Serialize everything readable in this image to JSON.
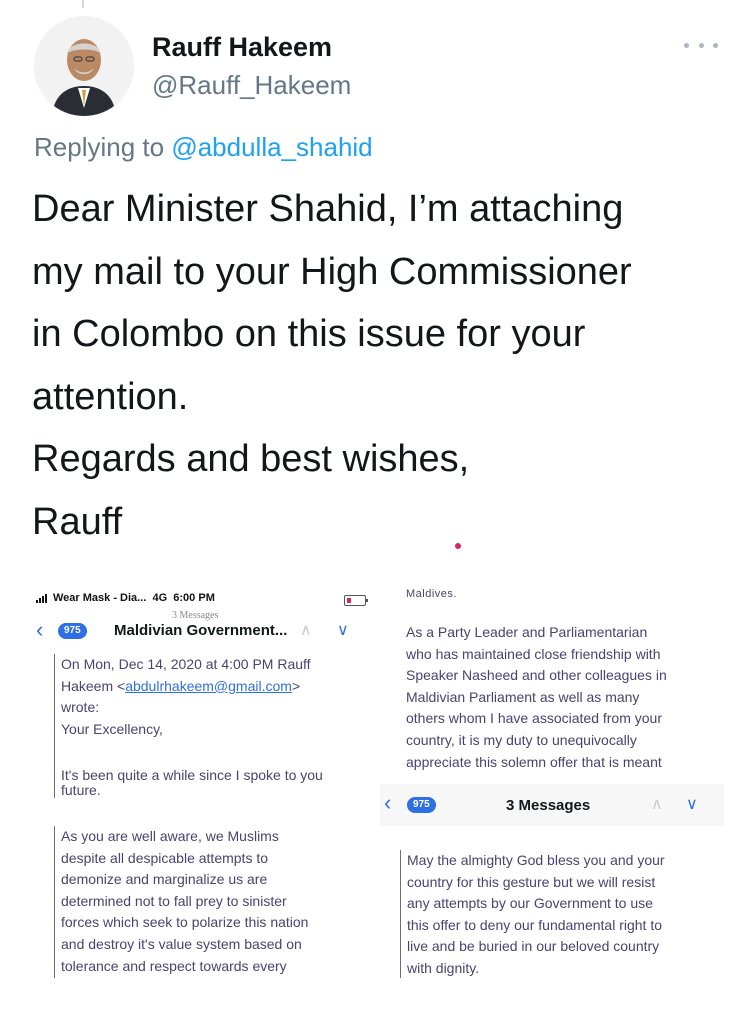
{
  "tweet": {
    "author_name": "Rauff Hakeem",
    "author_handle": "@Rauff_Hakeem",
    "replying_prefix": "Replying to",
    "replying_to": "@abdulla_shahid",
    "lines": [
      "Dear Minister Shahid, I’m attaching",
      "my mail to your High Commissioner",
      "in Colombo on this issue for your",
      "attention.",
      "Regards and best wishes,",
      "Rauff"
    ]
  },
  "attachment": {
    "left": {
      "status_carrier": "Wear Mask - Dia...",
      "status_network": "4G",
      "status_time": "6:00 PM",
      "message_count_small": "3 Messages",
      "badge": "975",
      "subject": "Maldivian Government...",
      "quote_header_1": "On Mon, Dec 14, 2020 at 4:00 PM Rauff",
      "quote_header_2_prefix": "Hakeem <",
      "quote_header_2_email": "abdulrhakeem@gmail.com",
      "quote_header_2_suffix": ">",
      "quote_header_3": "wrote:",
      "greeting": "Your Excellency,",
      "cut_line": "It's been quite a while since I spoke to you",
      "cut_line_2": "future.",
      "paragraph": [
        "As you are well aware, we Muslims",
        "despite all despicable attempts to",
        "demonize and marginalize us are",
        "determined not to fall prey to sinister",
        "forces which seek to polarize this nation",
        "and destroy it's value system based on",
        "tolerance  and respect towards every"
      ]
    },
    "right": {
      "cut_top": "Maldives.",
      "paragraph_1": [
        "As a Party Leader and Parliamentarian",
        "who has maintained close friendship with",
        "Speaker Nasheed and other colleagues in",
        "Maldivian Parliament as well as many",
        "others whom I have associated from your",
        "country, it is my duty to unequivocally",
        "appreciate this solemn offer that is meant"
      ],
      "badge": "975",
      "messages_title": "3 Messages",
      "paragraph_2": [
        "May the almighty God bless you and your",
        "country for this gesture but we will resist",
        "any attempts by our Government to use",
        "this offer to deny our fundamental right to",
        "live and be buried in our beloved country",
        "with dignity."
      ]
    }
  },
  "colors": {
    "link": "#1da1f2",
    "secondary_text": "#657786",
    "mail_text": "#4a4272",
    "ios_blue": "#2f6fe4"
  },
  "icons": [
    "more-icon",
    "back-chevron-icon",
    "up-chevron-icon",
    "down-chevron-icon",
    "signal-icon",
    "battery-icon",
    "avatar-photo"
  ]
}
